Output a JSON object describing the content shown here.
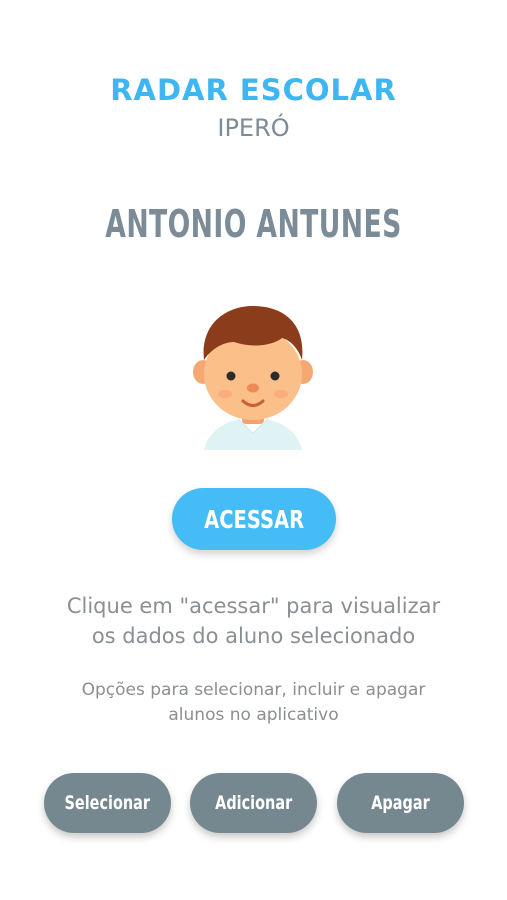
{
  "header": {
    "title": "RADAR ESCOLAR",
    "subtitle": "IPERÓ"
  },
  "student": {
    "name": "ANTONIO ANTUNES",
    "avatar_icon": "boy-avatar-icon"
  },
  "access_button": {
    "label": "ACESSAR"
  },
  "hints": {
    "main_line1": "Clique em \"acessar\" para visualizar",
    "main_line2": "os dados do aluno selecionado",
    "options_line1": "Opções para selecionar, incluir e apagar",
    "options_line2": "alunos no aplicativo"
  },
  "actions": {
    "select_label": "Selecionar",
    "add_label": "Adicionar",
    "delete_label": "Apagar"
  },
  "colors": {
    "accent": "#3db6f2",
    "button_primary": "#45bcf5",
    "button_secondary": "#76888f",
    "text_muted": "#8a8f93",
    "name_color": "#7b8b97"
  }
}
